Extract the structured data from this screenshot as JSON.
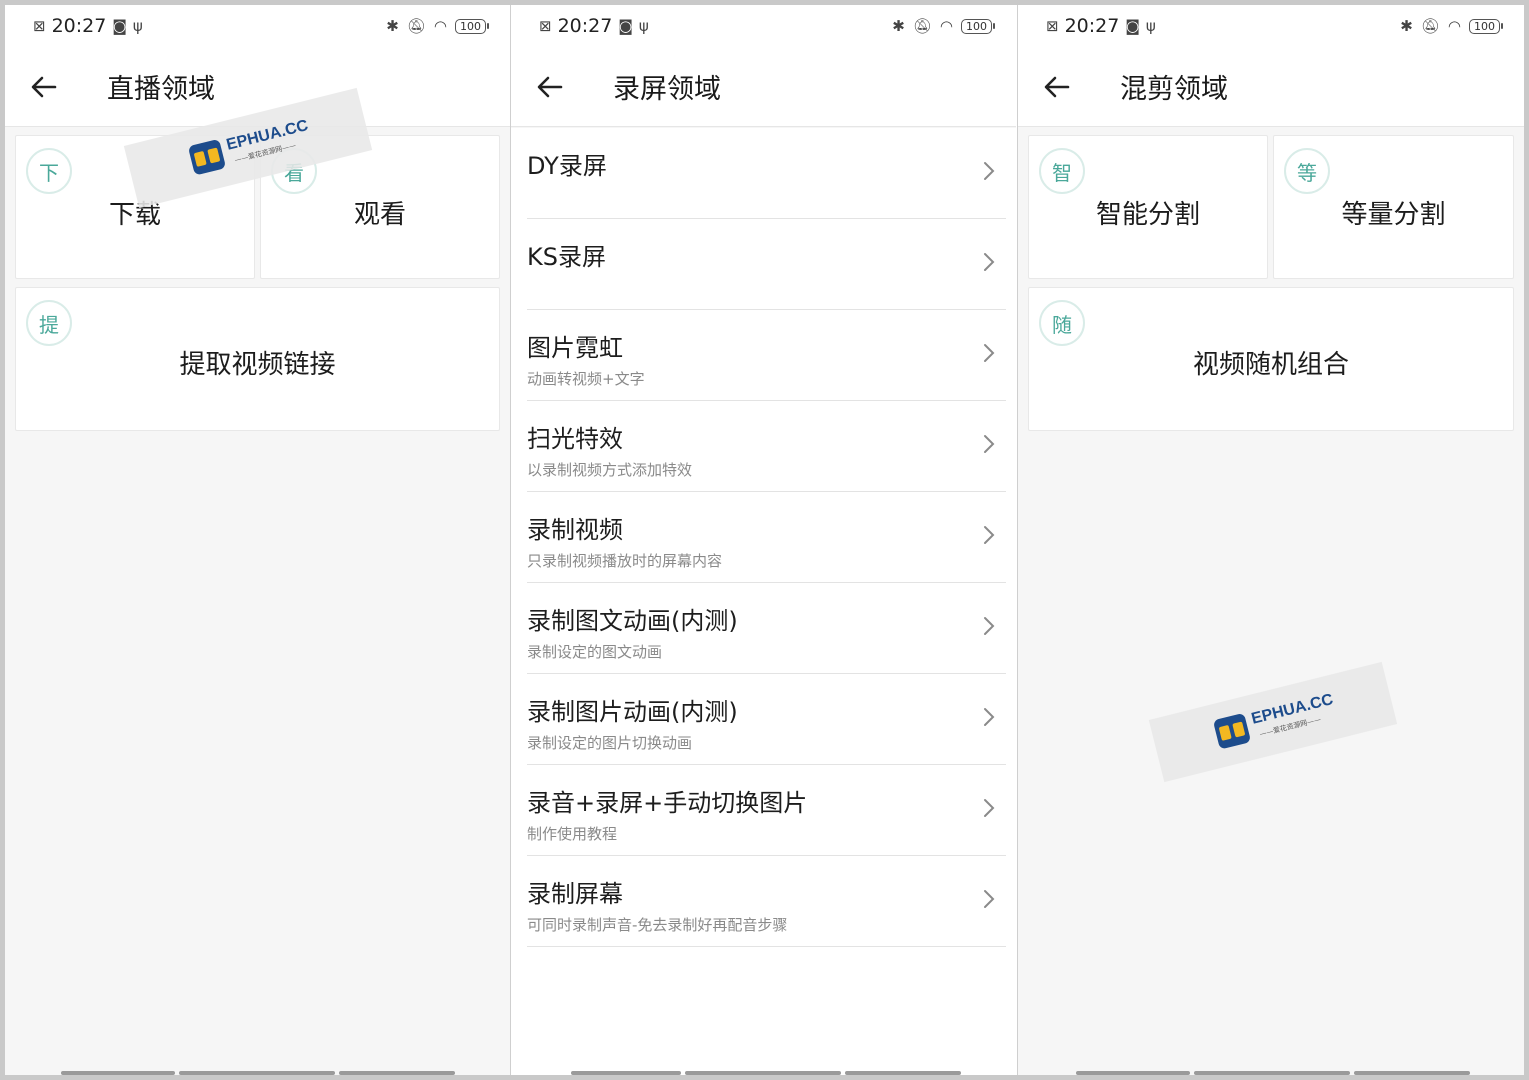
{
  "status_bar": {
    "time": "20:27",
    "battery": "100"
  },
  "screens": [
    {
      "title": "直播领域",
      "cards": [
        {
          "badge": "下",
          "label": "下载"
        },
        {
          "badge": "看",
          "label": "观看"
        },
        {
          "badge": "提",
          "label": "提取视频链接"
        }
      ]
    },
    {
      "title": "录屏领域",
      "items": [
        {
          "title": "DY录屏",
          "subtitle": ""
        },
        {
          "title": "KS录屏",
          "subtitle": ""
        },
        {
          "title": "图片霓虹",
          "subtitle": "动画转视频+文字"
        },
        {
          "title": "扫光特效",
          "subtitle": "以录制视频方式添加特效"
        },
        {
          "title": "录制视频",
          "subtitle": "只录制视频播放时的屏幕内容"
        },
        {
          "title": "录制图文动画(内测)",
          "subtitle": "录制设定的图文动画"
        },
        {
          "title": "录制图片动画(内测)",
          "subtitle": "录制设定的图片切换动画"
        },
        {
          "title": "录音+录屏+手动切换图片",
          "subtitle": "制作使用教程"
        },
        {
          "title": "录制屏幕",
          "subtitle": "可同时录制声音-免去录制好再配音步骤"
        }
      ]
    },
    {
      "title": "混剪领域",
      "cards": [
        {
          "badge": "智",
          "label": "智能分割"
        },
        {
          "badge": "等",
          "label": "等量分割"
        },
        {
          "badge": "随",
          "label": "视频随机组合"
        }
      ]
    }
  ],
  "watermark": {
    "text": "EPHUA.CC",
    "subtext": "——爱花资源网——"
  },
  "colors": {
    "accent": "#4aa89a",
    "background": "#f6f6f6",
    "card": "#ffffff"
  }
}
